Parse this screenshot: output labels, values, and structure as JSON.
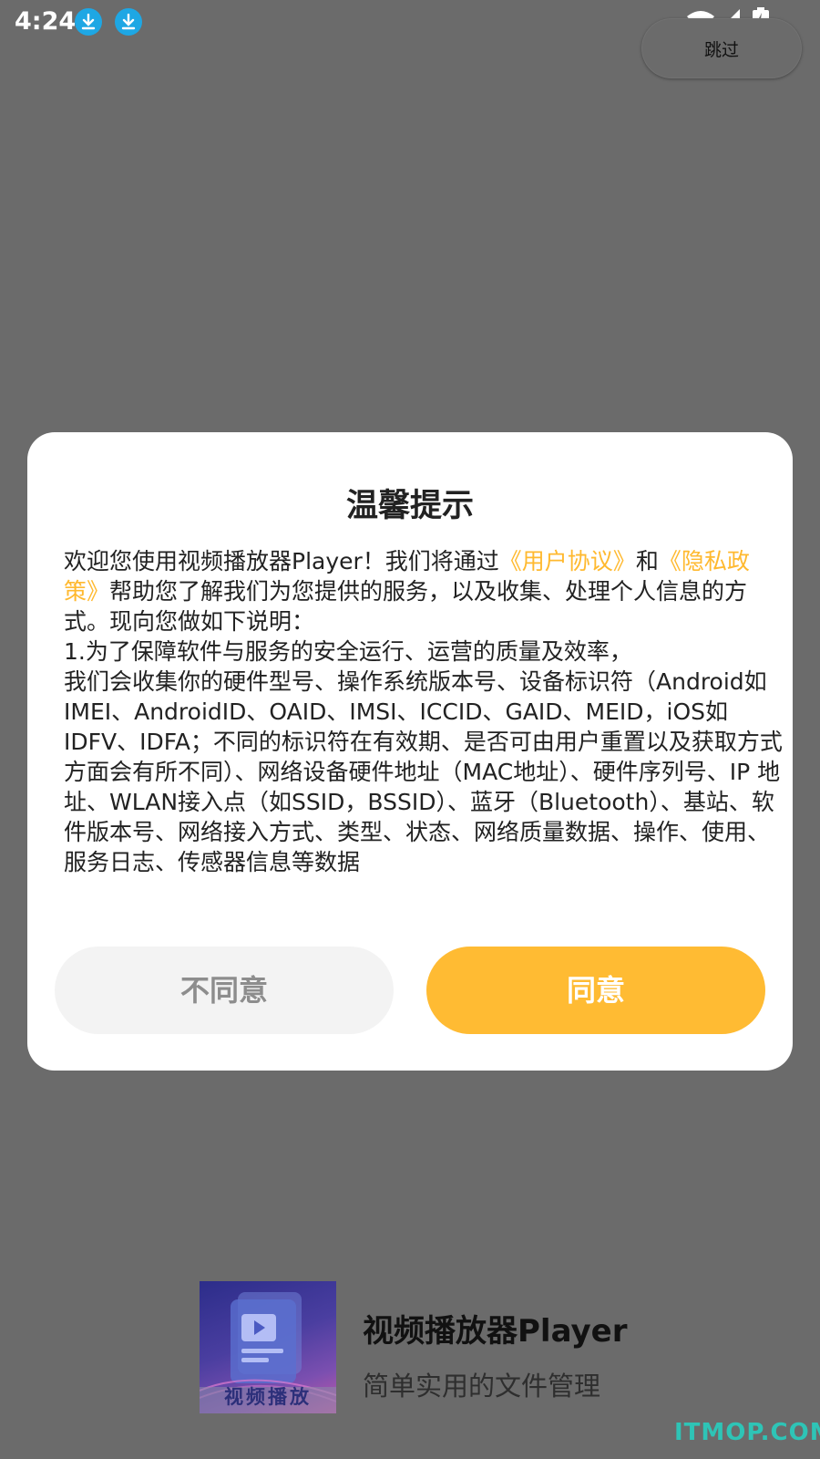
{
  "status_bar": {
    "time": "4:24",
    "icons": [
      "download-icon",
      "download-icon",
      "wifi-icon",
      "signal-icon",
      "battery-charging-icon"
    ]
  },
  "skip_button": {
    "label": "跳过"
  },
  "dialog": {
    "title": "温馨提示",
    "intro_prefix": "欢迎您使用视频播放器Player！我们将通过",
    "user_agreement_link": "《用户协议》",
    "conjunction": "和",
    "privacy_policy_link": "《隐私政策》",
    "intro_suffix": "帮助您了解我们为您提供的服务，以及收集、处理个人信息的方式。现向您做如下说明：",
    "item1_heading": "1.为了保障软件与服务的安全运行、运营的质量及效率，",
    "item1_body": "我们会收集你的硬件型号、操作系统版本号、设备标识符（Android如IMEI、AndroidID、OAID、IMSI、ICCID、GAID、MEID，iOS如IDFV、IDFA；不同的标识符在有效期、是否可由用户重置以及获取方式方面会有所不同）、网络设备硬件地址（MAC地址）、硬件序列号、IP 地址、WLAN接入点（如SSID，BSSID）、蓝牙（Bluetooth）、基站、软件版本号、网络接入方式、类型、状态、网络质量数据、操作、使用、服务日志、传感器信息等数据",
    "disagree_label": "不同意",
    "agree_label": "同意"
  },
  "splash": {
    "logo_text": "视频播放",
    "app_name": "视频播放器Player",
    "tagline": "简单实用的文件管理"
  },
  "watermark": "ITMOP.COM",
  "colors": {
    "overlay": "#6b6b6b",
    "accent": "#ffbb33",
    "link": "#ffb92f",
    "disagree_bg": "#f3f3f3"
  }
}
